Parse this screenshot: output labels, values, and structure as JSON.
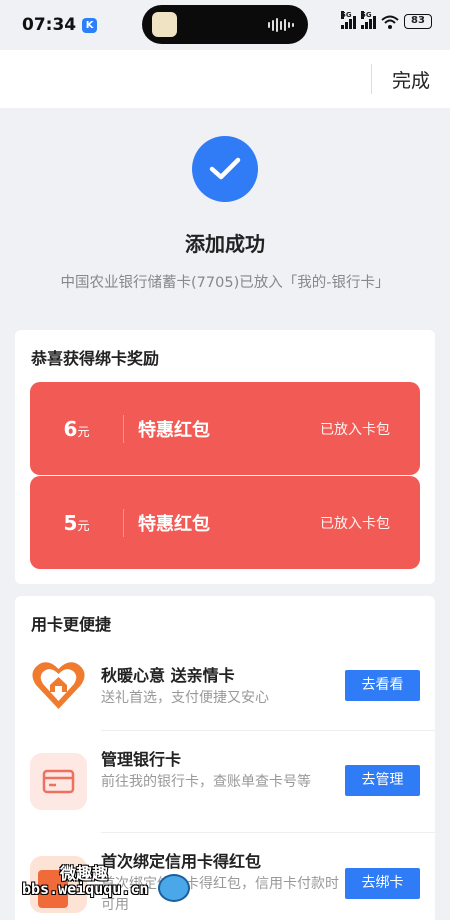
{
  "status_bar": {
    "time": "07:34",
    "badge": "K",
    "network_1": "5G",
    "network_2": "5G",
    "battery": "83"
  },
  "nav": {
    "done_label": "完成"
  },
  "success": {
    "title": "添加成功",
    "description": "中国农业银行储蓄卡(7705)已放入「我的-银行卡」"
  },
  "rewards": {
    "title": "恭喜获得绑卡奖励",
    "coupons": [
      {
        "amount": "6",
        "unit": "元",
        "name": "特惠红包",
        "status": "已放入卡包"
      },
      {
        "amount": "5",
        "unit": "元",
        "name": "特惠红包",
        "status": "已放入卡包"
      }
    ],
    "accent_color": "#f25b55"
  },
  "convenience": {
    "title": "用卡更便捷",
    "items": [
      {
        "title": "秋暖心意 送亲情卡",
        "desc": "送礼首选，支付便捷又安心",
        "button": "去看看",
        "icon": "heart-gift-icon"
      },
      {
        "title": "管理银行卡",
        "desc": "前往我的银行卡，查账单查卡号等",
        "button": "去管理",
        "icon": "bank-card-icon"
      },
      {
        "title": "首次绑定信用卡得红包",
        "desc": "首次绑定信用卡得红包，信用卡付款时可用",
        "button": "去绑卡",
        "icon": "red-packet-icon"
      }
    ],
    "button_color": "#2f7cf6"
  },
  "watermark": {
    "line1": "微趣趣",
    "line2": "bbs.weiququ.cn"
  }
}
